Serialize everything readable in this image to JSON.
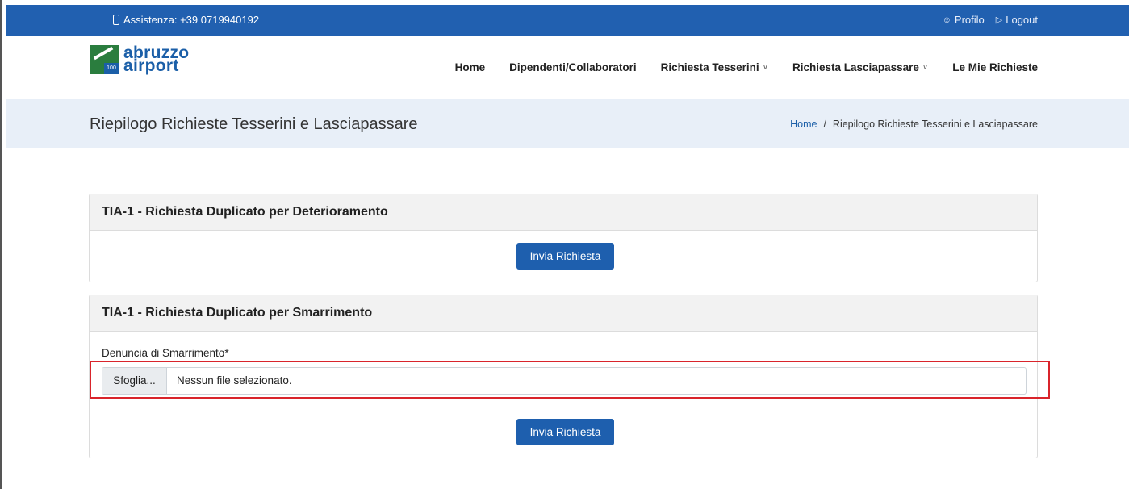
{
  "topbar": {
    "assistance": "Assistenza: +39 0719940192",
    "profile": "Profilo",
    "logout": "Logout"
  },
  "logo": {
    "line1": "abruzzo",
    "line2": "airport"
  },
  "nav": {
    "items": [
      {
        "label": "Home",
        "dropdown": false
      },
      {
        "label": "Dipendenti/Collaboratori",
        "dropdown": false
      },
      {
        "label": "Richiesta Tesserini",
        "dropdown": true
      },
      {
        "label": "Richiesta Lasciapassare",
        "dropdown": true
      },
      {
        "label": "Le Mie Richieste",
        "dropdown": false
      }
    ]
  },
  "band": {
    "title": "Riepilogo Richieste Tesserini e Lasciapassare",
    "breadcrumb_home": "Home",
    "breadcrumb_sep": "/",
    "breadcrumb_current": "Riepilogo Richieste Tesserini e Lasciapassare"
  },
  "card1": {
    "title": "TIA-1 - Richiesta Duplicato per Deterioramento",
    "button": "Invia Richiesta"
  },
  "card2": {
    "title": "TIA-1 - Richiesta Duplicato per Smarrimento",
    "field_label": "Denuncia di Smarrimento*",
    "browse_label": "Sfoglia...",
    "file_status": "Nessun file selezionato.",
    "button": "Invia Richiesta"
  },
  "colors": {
    "primary": "#1e5fae",
    "topbar": "#2160b0",
    "highlight": "#d9242b",
    "band": "#e8eff8"
  },
  "icons": [
    "phone-icon",
    "user-icon",
    "logout-icon",
    "chevron-down-icon"
  ]
}
